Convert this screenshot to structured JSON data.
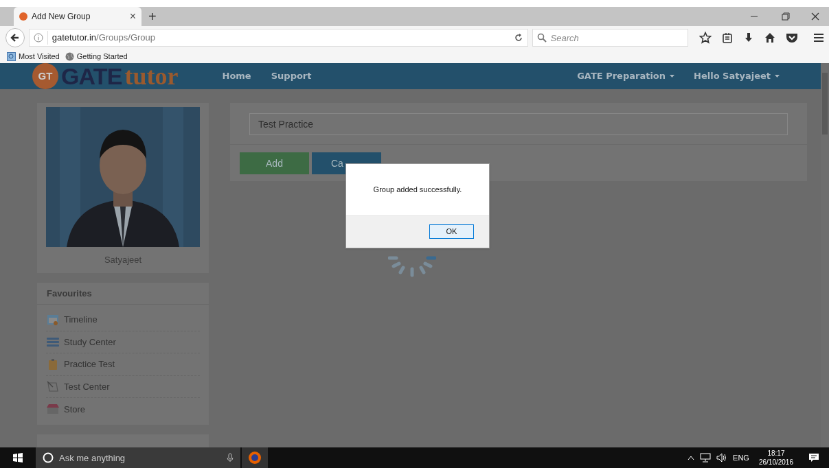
{
  "browser": {
    "tab": {
      "title": "Add New Group",
      "close": "×"
    },
    "new_tab": "+",
    "url": {
      "host": "gatetutor.in",
      "path": "/Groups/Group"
    },
    "search": {
      "placeholder": "Search"
    },
    "bookmarks": [
      "Most Visited",
      "Getting Started"
    ]
  },
  "site": {
    "logo": {
      "badge": "GT",
      "word1": "GATE",
      "word2": "tutor"
    },
    "nav": [
      "Home",
      "Support"
    ],
    "menus": [
      "GATE Preparation",
      "Hello Satyajeet"
    ]
  },
  "profile": {
    "name": "Satyajeet"
  },
  "favourites": {
    "title": "Favourites",
    "items": [
      "Timeline",
      "Study Center",
      "Practice Test",
      "Test Center",
      "Store"
    ]
  },
  "form": {
    "value": "Test Practice",
    "buttons": [
      {
        "label": "Add",
        "kind": "add"
      },
      {
        "label": "Ca",
        "kind": "cancel"
      }
    ]
  },
  "dialog": {
    "message": "Group added successfully.",
    "ok": "OK"
  },
  "taskbar": {
    "search": {
      "placeholder": "Ask me anything"
    },
    "lang": "ENG",
    "time": "18:17",
    "date": "26/10/2016"
  }
}
